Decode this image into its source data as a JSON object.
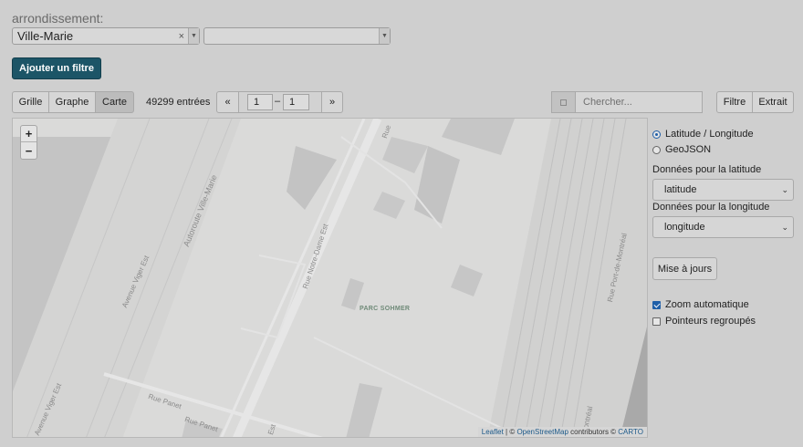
{
  "filter": {
    "label": "arrondissement:",
    "selected": "Ville-Marie",
    "clear_symbol": "×",
    "second_value": ""
  },
  "add_filter_label": "Ajouter un filtre",
  "toolbar": {
    "views": [
      "Grille",
      "Graphe",
      "Carte"
    ],
    "active_view": "Carte",
    "count_text": "49299 entrées",
    "prev_label": "«",
    "next_label": "»",
    "page_from": "1",
    "page_to": "1",
    "page_sep": "–",
    "search_placeholder": "Chercher...",
    "filter_btn": "Filtre",
    "extract_btn": "Extrait"
  },
  "map": {
    "zoom_in": "+",
    "zoom_out": "−",
    "labels": {
      "autoroute": "Autoroute Ville-Marie",
      "avenue_viger": "Avenue Viger Est",
      "notre_dame": "Rue Notre-Dame Est",
      "parc": "PARC SOHMER",
      "port_de_montreal": "Rue Port-de-Montréal",
      "panet_1": "Rue Panet",
      "panet_2": "Rue Panet",
      "viger_bottom": "Avenue Viger Est",
      "est_bottom": "Est",
      "montreal_bottom": "Montréal",
      "rue_top": "Rue"
    },
    "attribution": {
      "leaflet": "Leaflet",
      "sep": " | © ",
      "osm": "OpenStreetMap",
      "contrib": " contributors © ",
      "carto": "CARTO"
    }
  },
  "panel": {
    "coord_option": "Latitude / Longitude",
    "geojson_option": "GeoJSON",
    "lat_label": "Données pour la latitude",
    "lat_value": "latitude",
    "lon_label": "Données pour la longitude",
    "lon_value": "longitude",
    "update_btn": "Mise à jours",
    "auto_zoom": "Zoom automatique",
    "grouped": "Pointeurs regroupés"
  }
}
